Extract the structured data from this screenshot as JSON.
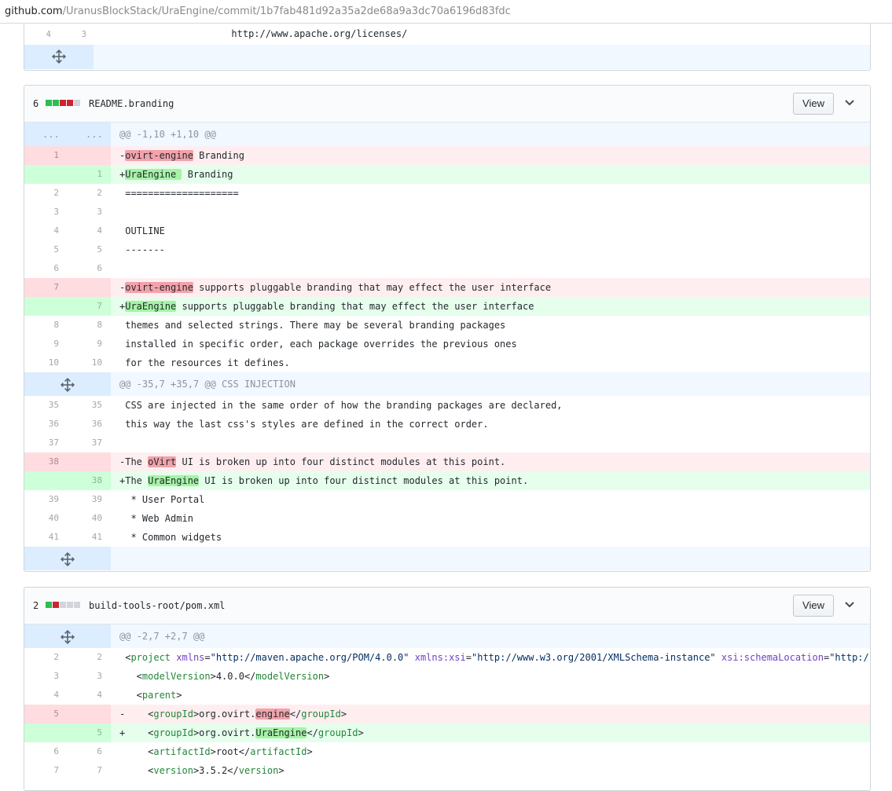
{
  "url": {
    "host": "github.com",
    "path": "/UranusBlockStack/UraEngine/commit/1b7fab481d92a35a2de68a9a3dc70a6196d83fdc"
  },
  "top_fragment": {
    "line": {
      "old": "4",
      "new": "3",
      "text": "                        http://www.apache.org/licenses/"
    }
  },
  "files": [
    {
      "count": "6",
      "diffstat": [
        "add",
        "add",
        "del",
        "del",
        "neutral"
      ],
      "name": "README.branding",
      "view_label": "View",
      "hunk1": "@@ -1,10 +1,10 @@",
      "hunk1_dots": [
        "...",
        "..."
      ],
      "rows_a": [
        {
          "type": "del",
          "old": "1",
          "new": "",
          "pre": "-",
          "hl": "ovirt-engine",
          "post": " Branding"
        },
        {
          "type": "add",
          "old": "",
          "new": "1",
          "pre": "+",
          "hl": "UraEngine ",
          "post": " Branding"
        },
        {
          "type": "ctx",
          "old": "2",
          "new": "2",
          "text": " ===================="
        },
        {
          "type": "ctx",
          "old": "3",
          "new": "3",
          "text": " "
        },
        {
          "type": "ctx",
          "old": "4",
          "new": "4",
          "text": " OUTLINE"
        },
        {
          "type": "ctx",
          "old": "5",
          "new": "5",
          "text": " -------"
        },
        {
          "type": "ctx",
          "old": "6",
          "new": "6",
          "text": " "
        },
        {
          "type": "del",
          "old": "7",
          "new": "",
          "pre": "-",
          "hl": "ovirt-engine",
          "post": " supports pluggable branding that may effect the user interface"
        },
        {
          "type": "add",
          "old": "",
          "new": "7",
          "pre": "+",
          "hl": "UraEngine",
          "post": " supports pluggable branding that may effect the user interface"
        },
        {
          "type": "ctx",
          "old": "8",
          "new": "8",
          "text": " themes and selected strings. There may be several branding packages"
        },
        {
          "type": "ctx",
          "old": "9",
          "new": "9",
          "text": " installed in specific order, each package overrides the previous ones"
        },
        {
          "type": "ctx",
          "old": "10",
          "new": "10",
          "text": " for the resources it defines."
        }
      ],
      "hunk2": "@@ -35,7 +35,7 @@ CSS INJECTION",
      "rows_b": [
        {
          "type": "ctx",
          "old": "35",
          "new": "35",
          "text": " CSS are injected in the same order of how the branding packages are declared,"
        },
        {
          "type": "ctx",
          "old": "36",
          "new": "36",
          "text": " this way the last css's styles are defined in the correct order."
        },
        {
          "type": "ctx",
          "old": "37",
          "new": "37",
          "text": " "
        },
        {
          "type": "del",
          "old": "38",
          "new": "",
          "pre": "-The ",
          "hl": "oVirt",
          "post": " UI is broken up into four distinct modules at this point."
        },
        {
          "type": "add",
          "old": "",
          "new": "38",
          "pre": "+The ",
          "hl": "UraEngine",
          "post": " UI is broken up into four distinct modules at this point."
        },
        {
          "type": "ctx",
          "old": "39",
          "new": "39",
          "text": "  * User Portal"
        },
        {
          "type": "ctx",
          "old": "40",
          "new": "40",
          "text": "  * Web Admin"
        },
        {
          "type": "ctx",
          "old": "41",
          "new": "41",
          "text": "  * Common widgets"
        }
      ]
    },
    {
      "count": "2",
      "diffstat": [
        "add",
        "del",
        "neutral",
        "neutral",
        "neutral"
      ],
      "name": "build-tools-root/pom.xml",
      "view_label": "View",
      "hunk1": "@@ -2,7 +2,7 @@",
      "rows_a": [
        {
          "type": "xml",
          "old": "2",
          "new": "2",
          "parts": [
            {
              "c": "",
              "t": " <"
            },
            {
              "c": "t-tag",
              "t": "project"
            },
            {
              "c": "",
              "t": " "
            },
            {
              "c": "t-attr",
              "t": "xmlns"
            },
            {
              "c": "",
              "t": "="
            },
            {
              "c": "t-str",
              "t": "\"http://maven.apache.org/POM/4.0.0\""
            },
            {
              "c": "",
              "t": " "
            },
            {
              "c": "t-attr",
              "t": "xmlns:xsi"
            },
            {
              "c": "",
              "t": "="
            },
            {
              "c": "t-str",
              "t": "\"http://www.w3.org/2001/XMLSchema-instance\""
            },
            {
              "c": "",
              "t": " "
            },
            {
              "c": "t-attr",
              "t": "xsi:schemaLocation"
            },
            {
              "c": "",
              "t": "="
            },
            {
              "c": "t-str",
              "t": "\"http:/"
            }
          ]
        },
        {
          "type": "xml",
          "old": "3",
          "new": "3",
          "parts": [
            {
              "c": "",
              "t": "   <"
            },
            {
              "c": "t-tag",
              "t": "modelVersion"
            },
            {
              "c": "",
              "t": ">4.0.0</"
            },
            {
              "c": "t-tag",
              "t": "modelVersion"
            },
            {
              "c": "",
              "t": ">"
            }
          ]
        },
        {
          "type": "xml",
          "old": "4",
          "new": "4",
          "parts": [
            {
              "c": "",
              "t": "   <"
            },
            {
              "c": "t-tag",
              "t": "parent"
            },
            {
              "c": "",
              "t": ">"
            }
          ]
        },
        {
          "type": "delx",
          "old": "5",
          "new": "",
          "parts": [
            {
              "c": "",
              "t": "-    <"
            },
            {
              "c": "t-tag",
              "t": "groupId"
            },
            {
              "c": "",
              "t": ">org.ovirt."
            },
            {
              "c": "hl-del",
              "t": "engine"
            },
            {
              "c": "",
              "t": "</"
            },
            {
              "c": "t-tag",
              "t": "groupId"
            },
            {
              "c": "",
              "t": ">"
            }
          ]
        },
        {
          "type": "addx",
          "old": "",
          "new": "5",
          "parts": [
            {
              "c": "",
              "t": "+    <"
            },
            {
              "c": "t-tag",
              "t": "groupId"
            },
            {
              "c": "",
              "t": ">org.ovirt."
            },
            {
              "c": "hl-add",
              "t": "UraEngine"
            },
            {
              "c": "",
              "t": "</"
            },
            {
              "c": "t-tag",
              "t": "groupId"
            },
            {
              "c": "",
              "t": ">"
            }
          ]
        },
        {
          "type": "xml",
          "old": "6",
          "new": "6",
          "parts": [
            {
              "c": "",
              "t": "     <"
            },
            {
              "c": "t-tag",
              "t": "artifactId"
            },
            {
              "c": "",
              "t": ">root</"
            },
            {
              "c": "t-tag",
              "t": "artifactId"
            },
            {
              "c": "",
              "t": ">"
            }
          ]
        },
        {
          "type": "xml",
          "old": "7",
          "new": "7",
          "parts": [
            {
              "c": "",
              "t": "     <"
            },
            {
              "c": "t-tag",
              "t": "version"
            },
            {
              "c": "",
              "t": ">3.5.2</"
            },
            {
              "c": "t-tag",
              "t": "version"
            },
            {
              "c": "",
              "t": ">"
            }
          ]
        }
      ]
    }
  ],
  "colors": {
    "add_bg": "#e6ffed",
    "del_bg": "#ffeef0",
    "hunk_bg": "#f1f8ff",
    "add_hl": "#a6f3a6",
    "del_hl": "#f1a2ab"
  },
  "icons": {
    "expand": "unfold-icon",
    "collapse": "chevron-down-icon"
  }
}
